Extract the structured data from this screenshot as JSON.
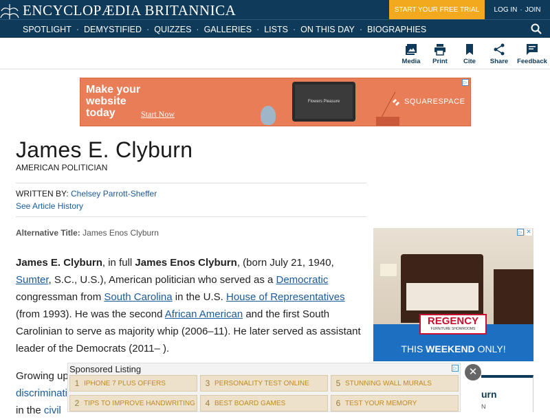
{
  "header": {
    "brand": "ENCYCLOPÆDIA BRITANNICA",
    "trial_label": "START YOUR FREE TRIAL",
    "login_label": "LOG IN",
    "join_label": "JOIN",
    "login_separator": "·"
  },
  "nav": {
    "items": [
      "SPOTLIGHT",
      "DEMYSTIFIED",
      "QUIZZES",
      "GALLERIES",
      "LISTS",
      "ON THIS DAY",
      "BIOGRAPHIES"
    ],
    "separator": "·"
  },
  "tools": {
    "media": "Media",
    "print": "Print",
    "cite": "Cite",
    "share": "Share",
    "feedback": "Feedback"
  },
  "ad_banner": {
    "headline_line1": "Make your",
    "headline_line2": "website",
    "headline_line3": "today",
    "cta": "Start Now",
    "screen_text": "Flowers Pleasure",
    "brand": "SQUARESPACE",
    "choice": "▷"
  },
  "article": {
    "title": "James E. Clyburn",
    "subtitle": "AMERICAN POLITICIAN",
    "written_by_label": "WRITTEN BY:",
    "author": "Chelsey Parrott-Sheffer",
    "history_link": "See Article History",
    "alt_title_label": "Alternative Title:",
    "alt_title_value": "James Enos Clyburn",
    "p1": {
      "name": "James E. Clyburn",
      "t1": ", in full ",
      "full_name": "James Enos Clyburn",
      "t2": ", (born July 21, 1940, ",
      "link_sumter": "Sumter",
      "t3": ", S.C., U.S.), American politician who served as a ",
      "link_democratic": "Democratic",
      "t4": " congressman from ",
      "link_sc": "South Carolina",
      "t5": " in the U.S. ",
      "link_house": "House of Representatives",
      "t6": " (from 1993). He was the second ",
      "link_aa": "African American",
      "t7": " and the first South Carolinian to serve as majority whip (2006–11). He later served as assistant leader of the Democrats (2011– )."
    },
    "p2_line1": "Growing up",
    "p2_line2_link": "discriminati",
    "p2_line3": "in the ",
    "p2_line3_link": "civil"
  },
  "ad_side": {
    "brand": "REGENCY",
    "brand_sub": "FURNITURE SHOWROOMS",
    "promo_prefix": "THIS ",
    "promo_bold": "WEEKEND",
    "promo_suffix": " ONLY!",
    "choice": "▷",
    "close": "✕"
  },
  "related": {
    "title": "urn",
    "subtitle": "N"
  },
  "sponsored": {
    "title": "Sponsored Listing",
    "choice": "▷",
    "items": [
      {
        "n": "1",
        "label": "iPhone 7 Plus Offers"
      },
      {
        "n": "2",
        "label": "Tips To Improve Handwriting"
      },
      {
        "n": "3",
        "label": "Personality Test Online"
      },
      {
        "n": "4",
        "label": "Best Board Games"
      },
      {
        "n": "5",
        "label": "Stunning Wall Murals"
      },
      {
        "n": "6",
        "label": "Test Your Memory"
      }
    ],
    "close": "✕"
  },
  "colors": {
    "navy": "#0f3a5a",
    "trial": "#f2a91e",
    "link": "#1a5a9a",
    "ad_orange": "#e87d58",
    "ad_blue": "#1d6fc2"
  }
}
